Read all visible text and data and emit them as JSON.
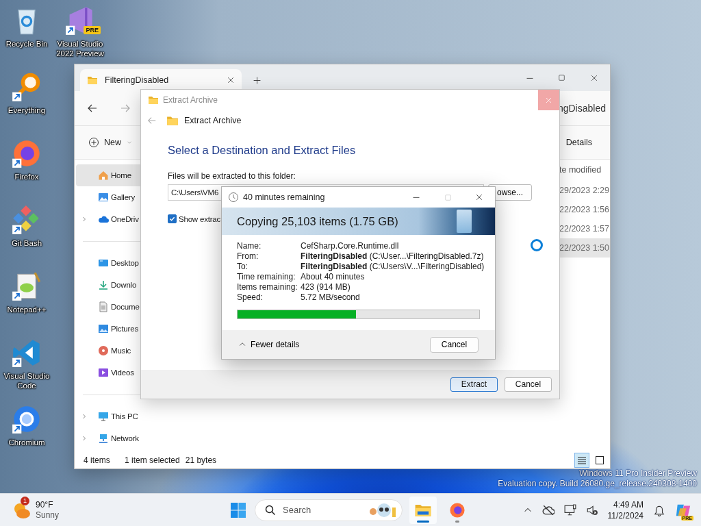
{
  "desktop_icons": [
    {
      "label": "Recycle Bin"
    },
    {
      "label": "Visual Studio 2022 Preview",
      "badge": "PRE"
    },
    {
      "label": "Everything"
    },
    {
      "label": "Firefox"
    },
    {
      "label": "Git Bash"
    },
    {
      "label": "Notepad++"
    },
    {
      "label": "Visual Studio Code"
    },
    {
      "label": "Chromium"
    }
  ],
  "explorer": {
    "tab": {
      "title": "FilteringDisabled"
    },
    "address": "ngDisabled",
    "toolbar": {
      "new_button": "New",
      "details_button": "Details"
    },
    "sidebar_groups": [
      [
        {
          "label": "Home",
          "selected": true,
          "expandable": false
        },
        {
          "label": "Gallery",
          "selected": false,
          "expandable": false
        },
        {
          "label": "OneDriv",
          "selected": false,
          "expandable": true
        }
      ],
      [
        {
          "label": "Desktop",
          "selected": false,
          "expandable": false
        },
        {
          "label": "Downlo",
          "selected": false,
          "expandable": false
        },
        {
          "label": "Docume",
          "selected": false,
          "expandable": false
        },
        {
          "label": "Pictures",
          "selected": false,
          "expandable": false
        },
        {
          "label": "Music",
          "selected": false,
          "expandable": false
        },
        {
          "label": "Videos",
          "selected": false,
          "expandable": false
        }
      ],
      [
        {
          "label": "This PC",
          "selected": false,
          "expandable": true
        },
        {
          "label": "Network",
          "selected": false,
          "expandable": true
        }
      ]
    ],
    "column_header": "te modified",
    "rows": [
      {
        "date": "29/2023 2:29",
        "selected": false
      },
      {
        "date": "22/2023 1:56",
        "selected": false
      },
      {
        "date": "22/2023 1:57",
        "selected": false
      },
      {
        "date": "22/2023 1:50",
        "selected": true
      }
    ],
    "status_bar": {
      "item_count": "4 items",
      "selection": "1 item selected",
      "selection_size": "21 bytes",
      "views": [
        {
          "selected": true
        },
        {
          "selected": false
        }
      ]
    }
  },
  "extract_dialog": {
    "title": "Extract Archive",
    "header": "Extract Archive",
    "heading": "Select a Destination and Extract Files",
    "folder_label": "Files will be extracted to this folder:",
    "folder_path": "C:\\Users\\VM6",
    "browse_button": "owse...",
    "show_files": {
      "label": "Show extrac",
      "checked": true
    },
    "buttons": [
      {
        "label": "Extract",
        "default": true
      },
      {
        "label": "Cancel",
        "default": false
      }
    ]
  },
  "copy_dialog": {
    "title": "40 minutes remaining",
    "heading": "Copying 25,103 items (1.75 GB)",
    "details": [
      {
        "label": "Name:",
        "value": "CefSharp.Core.Runtime.dll"
      },
      {
        "label": "From:",
        "value": "**FilteringDisabled** (C:\\User...\\FilteringDisabled.7z)"
      },
      {
        "label": "To:",
        "value": "**FilteringDisabled** (C:\\Users\\V...\\FilteringDisabled)"
      },
      {
        "label": "Time remaining:",
        "value": "About 40 minutes"
      },
      {
        "label": "Items remaining:",
        "value": "423 (914 MB)"
      },
      {
        "label": "Speed:",
        "value": "5.72 MB/second"
      }
    ],
    "progress": {
      "level": 0.49
    },
    "toggle": "Fewer details",
    "cancel_button": "Cancel"
  },
  "os_notice": [
    "Windows 11 Pro Insider Preview",
    "Evaluation copy. Build 26080.ge_release.240308-1400"
  ],
  "taskbar": {
    "weather": {
      "badge": "1",
      "temperature": "90°F",
      "condition": "Sunny"
    },
    "search": {
      "label": "Search"
    },
    "apps": [
      {
        "active": true
      },
      {
        "active": false
      }
    ],
    "time": "4:49 AM",
    "date": "11/2/2024",
    "copilot_badge": "PRE"
  }
}
